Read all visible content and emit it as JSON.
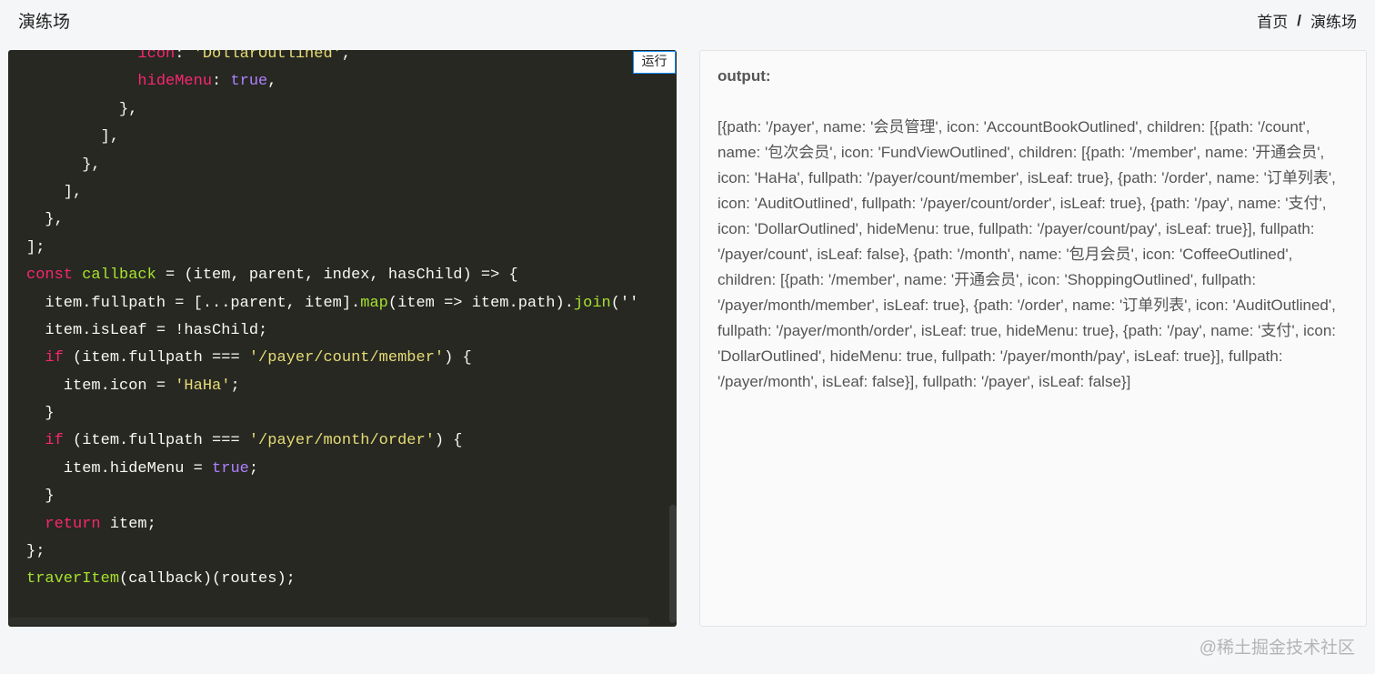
{
  "header": {
    "title": "演练场",
    "breadcrumb": {
      "home": "首页",
      "separator": "/",
      "current": "演练场"
    }
  },
  "editor": {
    "run_label": "运行",
    "code_lines": [
      [
        {
          "t": "            "
        },
        {
          "t": "icon",
          "c": "prop"
        },
        {
          "t": ": "
        },
        {
          "t": "'DollarOutlined'",
          "c": "str"
        },
        {
          "t": ","
        }
      ],
      [
        {
          "t": "            "
        },
        {
          "t": "hideMenu",
          "c": "prop"
        },
        {
          "t": ": "
        },
        {
          "t": "true",
          "c": "bool"
        },
        {
          "t": ","
        }
      ],
      [
        {
          "t": "          },"
        }
      ],
      [
        {
          "t": "        ],"
        }
      ],
      [
        {
          "t": "      },"
        }
      ],
      [
        {
          "t": "    ],"
        }
      ],
      [
        {
          "t": "  },"
        }
      ],
      [
        {
          "t": "];"
        }
      ],
      [
        {
          "t": "const",
          "c": "kw"
        },
        {
          "t": " "
        },
        {
          "t": "callback",
          "c": "fn"
        },
        {
          "t": " = (item, parent, index, hasChild) => {"
        }
      ],
      [
        {
          "t": "  item.fullpath = [...parent, item]."
        },
        {
          "t": "map",
          "c": "fn"
        },
        {
          "t": "(item => item.path)."
        },
        {
          "t": "join",
          "c": "fn"
        },
        {
          "t": "(''"
        }
      ],
      [
        {
          "t": "  item.isLeaf = !hasChild;"
        }
      ],
      [
        {
          "t": "  "
        },
        {
          "t": "if",
          "c": "kw"
        },
        {
          "t": " (item.fullpath === "
        },
        {
          "t": "'/payer/count/member'",
          "c": "str"
        },
        {
          "t": ") {"
        }
      ],
      [
        {
          "t": "    item.icon = "
        },
        {
          "t": "'HaHa'",
          "c": "str"
        },
        {
          "t": ";"
        }
      ],
      [
        {
          "t": "  }"
        }
      ],
      [
        {
          "t": "  "
        },
        {
          "t": "if",
          "c": "kw"
        },
        {
          "t": " (item.fullpath === "
        },
        {
          "t": "'/payer/month/order'",
          "c": "str"
        },
        {
          "t": ") {"
        }
      ],
      [
        {
          "t": "    item.hideMenu = "
        },
        {
          "t": "true",
          "c": "bool"
        },
        {
          "t": ";"
        }
      ],
      [
        {
          "t": "  }"
        }
      ],
      [
        {
          "t": "  "
        },
        {
          "t": "return",
          "c": "kw"
        },
        {
          "t": " item;"
        }
      ],
      [
        {
          "t": "};"
        }
      ],
      [
        {
          "t": "traverItem",
          "c": "fn"
        },
        {
          "t": "(callback)(routes);"
        }
      ]
    ]
  },
  "output": {
    "label": "output:",
    "text": "[{path: '/payer', name: '会员管理', icon: 'AccountBookOutlined', children: [{path: '/count', name: '包次会员', icon: 'FundViewOutlined', children: [{path: '/member', name: '开通会员', icon: 'HaHa', fullpath: '/payer/count/member', isLeaf: true}, {path: '/order', name: '订单列表', icon: 'AuditOutlined', fullpath: '/payer/count/order', isLeaf: true}, {path: '/pay', name: '支付', icon: 'DollarOutlined', hideMenu: true, fullpath: '/payer/count/pay', isLeaf: true}], fullpath: '/payer/count', isLeaf: false}, {path: '/month', name: '包月会员', icon: 'CoffeeOutlined', children: [{path: '/member', name: '开通会员', icon: 'ShoppingOutlined', fullpath: '/payer/month/member', isLeaf: true}, {path: '/order', name: '订单列表', icon: 'AuditOutlined', fullpath: '/payer/month/order', isLeaf: true, hideMenu: true}, {path: '/pay', name: '支付', icon: 'DollarOutlined', hideMenu: true, fullpath: '/payer/month/pay', isLeaf: true}], fullpath: '/payer/month', isLeaf: false}], fullpath: '/payer', isLeaf: false}]"
  },
  "watermark": "@稀土掘金技术社区"
}
